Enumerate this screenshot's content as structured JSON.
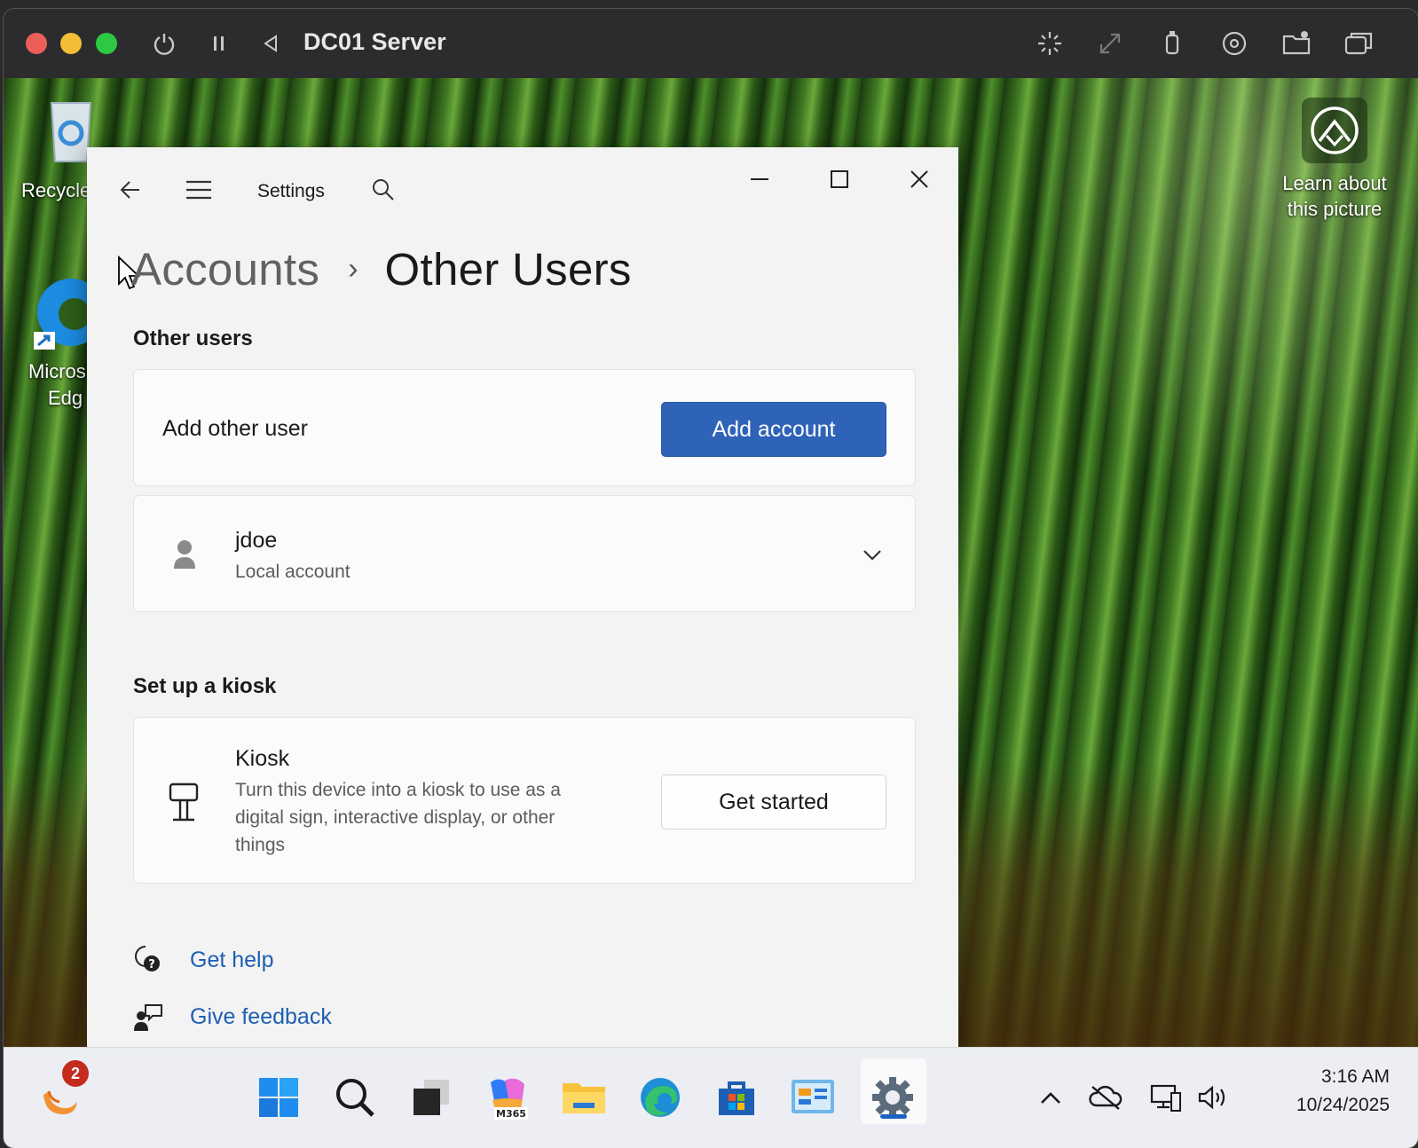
{
  "vm": {
    "title": "DC01 Server",
    "controls": [
      "power-icon",
      "pause-icon",
      "back-icon"
    ],
    "right_icons": [
      "brightness-icon",
      "resize-icon",
      "usb-icon",
      "disc-icon",
      "shared-folder-icon",
      "windows-icon"
    ]
  },
  "desktop": {
    "icons": [
      {
        "name": "recycle-bin-icon",
        "label": "Recycle"
      },
      {
        "name": "edge-icon",
        "label_line1": "Micros",
        "label_line2": "Edg"
      }
    ],
    "learn_picture": {
      "line1": "Learn about",
      "line2": "this picture"
    }
  },
  "settings": {
    "title": "Settings",
    "breadcrumb": {
      "parent": "Accounts",
      "separator": "›",
      "current": "Other Users"
    },
    "other_users": {
      "heading": "Other users",
      "add_row_label": "Add other user",
      "add_button": "Add account",
      "user": {
        "name": "jdoe",
        "type": "Local account"
      }
    },
    "kiosk": {
      "heading": "Set up a kiosk",
      "title": "Kiosk",
      "desc_line1": "Turn this device into a kiosk to use as a",
      "desc_line2": "digital sign, interactive display, or other",
      "desc_line3": "things",
      "button": "Get started"
    },
    "links": {
      "help": "Get help",
      "feedback": "Give feedback"
    }
  },
  "taskbar": {
    "notification_badge": "2",
    "apps": [
      "widgets-icon",
      "start-icon",
      "search-icon",
      "task-view-icon",
      "m365-icon",
      "file-explorer-icon",
      "edge-icon",
      "store-icon",
      "control-panel-icon",
      "settings-icon"
    ],
    "m365_label": "M365",
    "tray": [
      "chevron-up-icon",
      "cloud-off-icon",
      "network-icon",
      "volume-icon"
    ],
    "time": "3:16 AM",
    "date": "10/24/2025"
  },
  "colors": {
    "accent": "#2f63b8",
    "link": "#1d5fb3",
    "window_bg": "#f3f3f3"
  }
}
